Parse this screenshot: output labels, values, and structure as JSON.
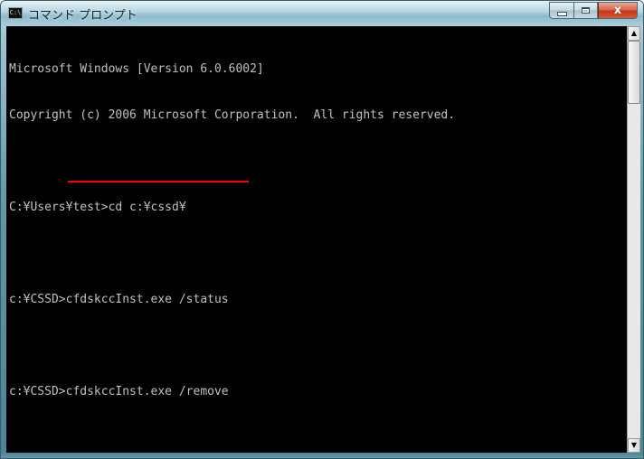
{
  "window": {
    "title": "コマンド プロンプト",
    "icon_label": "C:\\",
    "icon": "console-app-icon"
  },
  "caption_buttons": {
    "minimize_icon": "minimize-icon",
    "maximize_icon": "maximize-icon",
    "close_glyph": "x",
    "close_color": "#c1391a"
  },
  "console": {
    "background": "#000000",
    "text_color": "#c0c0c0",
    "lines": [
      "Microsoft Windows [Version 6.0.6002]",
      "Copyright (c) 2006 Microsoft Corporation.  All rights reserved.",
      "",
      "C:¥Users¥test>cd c:¥cssd¥",
      "",
      "c:¥CSSD>cfdskccInst.exe /status",
      "",
      "c:¥CSSD>cfdskccInst.exe /remove"
    ],
    "highlight_color": "#ff0000"
  },
  "scrollbar": {
    "up_glyph": "▲",
    "down_glyph": "▼"
  }
}
